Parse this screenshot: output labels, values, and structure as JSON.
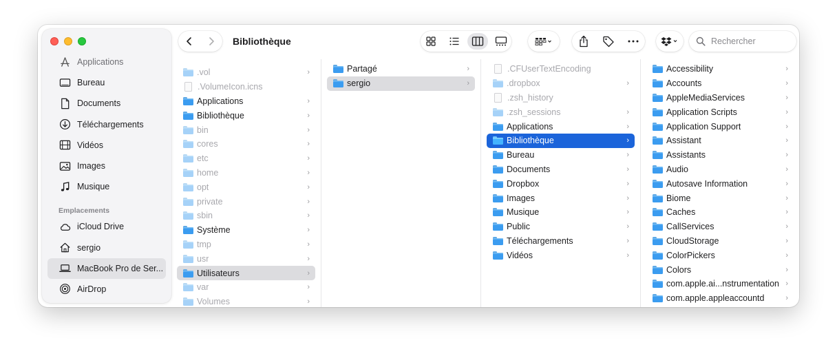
{
  "window": {
    "title": "Bibliothèque"
  },
  "sidebar": {
    "items": [
      {
        "label": "Applications",
        "icon": "applications-icon"
      },
      {
        "label": "Bureau",
        "icon": "desktop-icon"
      },
      {
        "label": "Documents",
        "icon": "document-icon"
      },
      {
        "label": "Téléchargements",
        "icon": "download-icon"
      },
      {
        "label": "Vidéos",
        "icon": "film-icon"
      },
      {
        "label": "Images",
        "icon": "photo-icon"
      },
      {
        "label": "Musique",
        "icon": "music-note-icon"
      }
    ],
    "section_label": "Emplacements",
    "locations": [
      {
        "label": "iCloud Drive",
        "icon": "cloud-icon"
      },
      {
        "label": "sergio",
        "icon": "home-icon"
      },
      {
        "label": "MacBook Pro de Ser...",
        "icon": "laptop-icon",
        "selected": true
      },
      {
        "label": "AirDrop",
        "icon": "airdrop-icon"
      }
    ]
  },
  "toolbar": {
    "back_icon": "chevron-left-icon",
    "forward_icon": "chevron-right-icon",
    "view_modes": [
      "grid-view-icon",
      "list-view-icon",
      "column-view-icon",
      "gallery-view-icon"
    ],
    "active_view": "column-view-icon",
    "search_placeholder": "Rechercher"
  },
  "columns": [
    {
      "items": [
        {
          "name": ".vol",
          "hidden": true
        },
        {
          "name": ".VolumeIcon.icns",
          "hidden": true,
          "file": true
        },
        {
          "name": "Applications"
        },
        {
          "name": "Bibliothèque"
        },
        {
          "name": "bin",
          "hidden": true
        },
        {
          "name": "cores",
          "hidden": true
        },
        {
          "name": "etc",
          "hidden": true
        },
        {
          "name": "home",
          "hidden": true
        },
        {
          "name": "opt",
          "hidden": true
        },
        {
          "name": "private",
          "hidden": true
        },
        {
          "name": "sbin",
          "hidden": true
        },
        {
          "name": "Système"
        },
        {
          "name": "tmp",
          "hidden": true
        },
        {
          "name": "usr",
          "hidden": true
        },
        {
          "name": "Utilisateurs",
          "selected": "grey"
        },
        {
          "name": "var",
          "hidden": true
        },
        {
          "name": "Volumes",
          "hidden": true
        }
      ]
    },
    {
      "items": [
        {
          "name": "Partagé"
        },
        {
          "name": "sergio",
          "selected": "grey"
        }
      ]
    },
    {
      "items": [
        {
          "name": ".CFUserTextEncoding",
          "hidden": true,
          "file": true
        },
        {
          "name": ".dropbox",
          "hidden": true
        },
        {
          "name": ".zsh_history",
          "hidden": true,
          "file": true
        },
        {
          "name": ".zsh_sessions",
          "hidden": true
        },
        {
          "name": "Applications"
        },
        {
          "name": "Bibliothèque",
          "selected": "blue"
        },
        {
          "name": "Bureau"
        },
        {
          "name": "Documents"
        },
        {
          "name": "Dropbox"
        },
        {
          "name": "Images"
        },
        {
          "name": "Musique"
        },
        {
          "name": "Public"
        },
        {
          "name": "Téléchargements"
        },
        {
          "name": "Vidéos"
        }
      ]
    },
    {
      "items": [
        {
          "name": "Accessibility"
        },
        {
          "name": "Accounts"
        },
        {
          "name": "AppleMediaServices"
        },
        {
          "name": "Application Scripts"
        },
        {
          "name": "Application Support"
        },
        {
          "name": "Assistant"
        },
        {
          "name": "Assistants"
        },
        {
          "name": "Audio"
        },
        {
          "name": "Autosave Information"
        },
        {
          "name": "Biome"
        },
        {
          "name": "Caches"
        },
        {
          "name": "CallServices"
        },
        {
          "name": "CloudStorage"
        },
        {
          "name": "ColorPickers"
        },
        {
          "name": "Colors"
        },
        {
          "name": "com.apple.ai...nstrumentation"
        },
        {
          "name": "com.apple.appleaccountd"
        }
      ]
    }
  ],
  "colors": {
    "accent": "#1b64da",
    "folder": "#3b9cf0"
  }
}
